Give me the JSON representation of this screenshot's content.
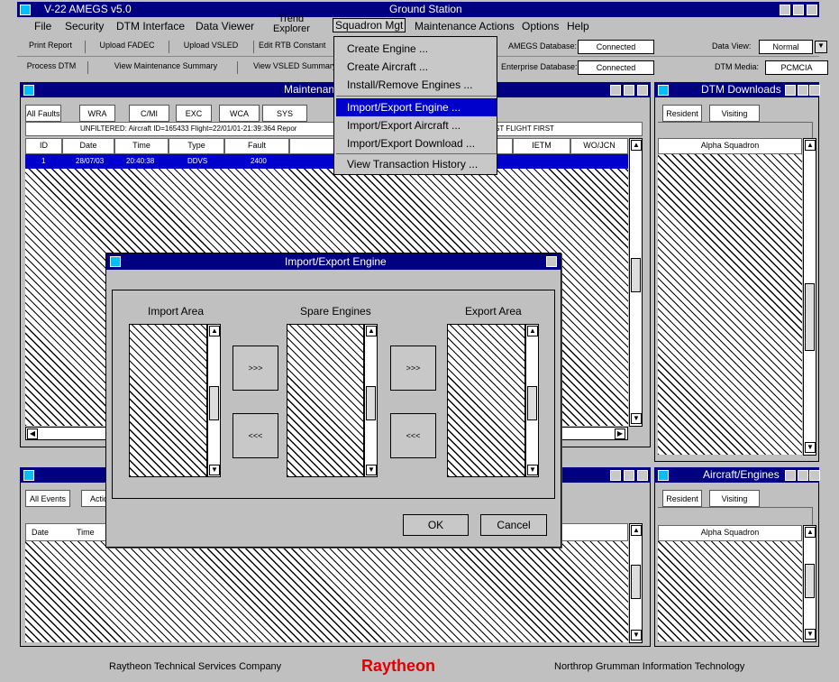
{
  "app": {
    "title": "V-22 AMEGS v5.0",
    "station": "Ground Station"
  },
  "menu": {
    "file": "File",
    "security": "Security",
    "dtm_interface": "DTM Interface",
    "data_viewer": "Data Viewer",
    "trend_explorer_line1": "Trend",
    "trend_explorer_line2": "Explorer",
    "squadron_mgt": "Squadron Mgt",
    "maintenance_actions": "Maintenance Actions",
    "options": "Options",
    "help": "Help"
  },
  "dropdown": {
    "create_engine": "Create Engine ...",
    "create_aircraft": "Create Aircraft ...",
    "install_remove": "Install/Remove Engines ...",
    "import_export_engine": "Import/Export Engine ...",
    "import_export_aircraft": "Import/Export Aircraft ...",
    "import_export_download": "Import/Export Download ...",
    "view_transaction_history": "View Transaction History ..."
  },
  "toolbar": {
    "print_report": "Print Report",
    "upload_fadec": "Upload FADEC",
    "upload_vsled": "Upload VSLED",
    "edit_rtb": "Edit RTB Constant",
    "process_dtm": "Process DTM",
    "view_maint_summary": "View Maintenance Summary",
    "view_vsled_summary": "View VSLED Summary",
    "amegs_db_label": "AMEGS Database:",
    "amegs_db_value": "Connected",
    "enterprise_db_label": "Enterprise Database:",
    "enterprise_db_value": "Connected",
    "data_view_label": "Data View:",
    "data_view_value": "Normal",
    "dtm_media_label": "DTM Media:",
    "dtm_media_value": "PCMCIA"
  },
  "maint_panel": {
    "title": "Maintenance",
    "tabs": [
      "All Faults",
      "WRA",
      "C/MI",
      "EXC",
      "WCA",
      "SYS"
    ],
    "filter_text": "UNFILTERED:  Aircraft ID=165433  Flight=22/01/01-21:39:364  Repor",
    "filter_right": "ST FLIGHT FIRST",
    "columns": [
      "ID",
      "Date",
      "Time",
      "Type",
      "Fault"
    ],
    "columns_right": [
      "IETM",
      "WO/JCN"
    ],
    "row": {
      "id": "1",
      "date": "28/07/03",
      "time": "20:40:38",
      "type": "DDVS",
      "fault": "2400"
    }
  },
  "dtm_panel": {
    "title": "DTM Downloads",
    "tabs": [
      "Resident",
      "Visiting"
    ],
    "list_header": "Alpha Squadron"
  },
  "events_panel": {
    "tabs": [
      "All Events",
      "Actio"
    ],
    "columns": [
      "Date",
      "Time"
    ]
  },
  "aircraft_panel": {
    "title": "Aircraft/Engines",
    "tabs": [
      "Resident",
      "Visiting"
    ],
    "list_header": "Alpha Squadron"
  },
  "dialog": {
    "title": "Import/Export Engine",
    "import_area": "Import Area",
    "spare_engines": "Spare Engines",
    "export_area": "Export Area",
    "move_right": ">>>",
    "move_left": "<<<",
    "ok": "OK",
    "cancel": "Cancel"
  },
  "footer": {
    "left": "Raytheon Technical Services Company",
    "center": "Raytheon",
    "right": "Northrop Grumman Information Technology"
  },
  "colors": {
    "titlebar": "#000080",
    "accent": "#00bfff",
    "raytheon_red": "#e00000",
    "selection": "#0000cc"
  }
}
